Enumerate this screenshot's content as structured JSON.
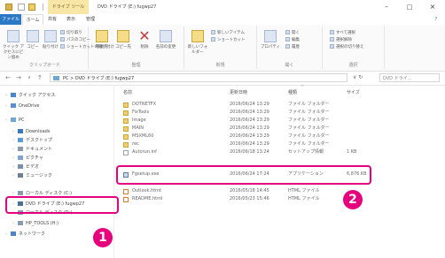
{
  "window": {
    "title": "DVD ドライブ (E:) fugwp27",
    "context_tab": "ドライブ ツール",
    "minimize": "–",
    "maximize": "□",
    "close": "×"
  },
  "ribbon_tabs": [
    "ファイル",
    "ホーム",
    "共有",
    "表示",
    "管理"
  ],
  "ribbon": {
    "groups": [
      {
        "label": "クリップボード",
        "buttons": [
          "クイック アクセスにピン留め",
          "コピー",
          "貼り付け"
        ],
        "small": [
          "切り取り",
          "パスのコピー",
          "ショートカットの貼り付け"
        ]
      },
      {
        "label": "整理",
        "buttons": [
          "移動先",
          "コピー先",
          "削除",
          "名前の変更"
        ]
      },
      {
        "label": "新規",
        "buttons": [
          "新しいフォルダー"
        ],
        "small": [
          "新しいアイテム",
          "ショートカット"
        ]
      },
      {
        "label": "開く",
        "buttons": [
          "プロパティ"
        ],
        "small": [
          "開く",
          "編集",
          "履歴"
        ]
      },
      {
        "label": "選択",
        "small": [
          "すべて選択",
          "選択解除",
          "選択の切り替え"
        ]
      }
    ],
    "help": "?"
  },
  "address": {
    "path": "PC > DVD ドライブ (E:) fugwp27",
    "search_placeholder": "DVD ドライ...",
    "refresh": "∨ ↻"
  },
  "nav": {
    "items": [
      {
        "label": "クイック アクセス",
        "icon": "star-icon",
        "color": "#4a86c7"
      },
      {
        "label": "OneDrive",
        "icon": "cloud-icon",
        "color": "#5a8fd0"
      },
      {
        "label": "PC",
        "icon": "pc-icon",
        "color": "#6da7d6"
      },
      {
        "label": "Downloads",
        "icon": "download-icon",
        "color": "#3d78b8"
      },
      {
        "label": "デスクトップ",
        "icon": "folder-icon",
        "color": "#5d9bd6"
      },
      {
        "label": "ドキュメント",
        "icon": "folder-icon",
        "color": "#8a98aa"
      },
      {
        "label": "ピクチャ",
        "icon": "folder-icon",
        "color": "#7fa3c9"
      },
      {
        "label": "ビデオ",
        "icon": "folder-icon",
        "color": "#7b8ea7"
      },
      {
        "label": "ミュージック",
        "icon": "music-icon",
        "color": "#6e7f95"
      },
      {
        "label": "ローカル ディスク (C:)",
        "icon": "drive-icon",
        "color": "#8a9bb0"
      },
      {
        "label": "DVD ドライブ (E:) fugwp27",
        "icon": "dvd-icon",
        "color": "#4b6f97"
      },
      {
        "label": "ローカル ディスク (D:)",
        "icon": "drive-icon",
        "color": "#8a9bb0"
      },
      {
        "label": "HP_TOOLS (H:)",
        "icon": "drive-icon",
        "color": "#8a9bb0"
      },
      {
        "label": "ネットワーク",
        "icon": "network-icon",
        "color": "#4a86c7"
      }
    ]
  },
  "columns": [
    "名前",
    "更新日時",
    "種類",
    "サイズ"
  ],
  "files": [
    {
      "name": "DOTNETFX",
      "date": "2016/06/24 13:29",
      "type": "ファイル フォルダー",
      "size": "",
      "icon": "folder"
    },
    {
      "name": "FixTools",
      "date": "2016/06/24 13:29",
      "type": "ファイル フォルダー",
      "size": "",
      "icon": "folder"
    },
    {
      "name": "Image",
      "date": "2016/06/24 13:29",
      "type": "ファイル フォルダー",
      "size": "",
      "icon": "folder"
    },
    {
      "name": "MAIN",
      "date": "2016/06/24 13:29",
      "type": "ファイル フォルダー",
      "size": "",
      "icon": "folder"
    },
    {
      "name": "MSXML60",
      "date": "2016/06/24 13:29",
      "type": "ファイル フォルダー",
      "size": "",
      "icon": "folder"
    },
    {
      "name": "rec",
      "date": "2016/06/24 13:29",
      "type": "ファイル フォルダー",
      "size": "",
      "icon": "folder"
    },
    {
      "name": "Autorun.inf",
      "date": "2016/06/18 13:24",
      "type": "セットアップ情報",
      "size": "1 KB",
      "icon": "doc"
    },
    {
      "name": "Fgsetup.exe",
      "date": "2016/06/24 17:24",
      "type": "アプリケーション",
      "size": "6,876 KB",
      "icon": "exe"
    },
    {
      "name": "Outlook.htmt",
      "date": "2016/05/18 14:45",
      "type": "HTML ファイル",
      "size": "",
      "icon": "html"
    },
    {
      "name": "README.html",
      "date": "2016/05/23 15:46",
      "type": "HTML ファイル",
      "size": "",
      "icon": "html"
    }
  ],
  "badges": [
    "1",
    "2"
  ],
  "colors": {
    "highlight": "#e6007e",
    "file_tab": "#2b78c7",
    "context_tab": "#f7e6a6"
  }
}
